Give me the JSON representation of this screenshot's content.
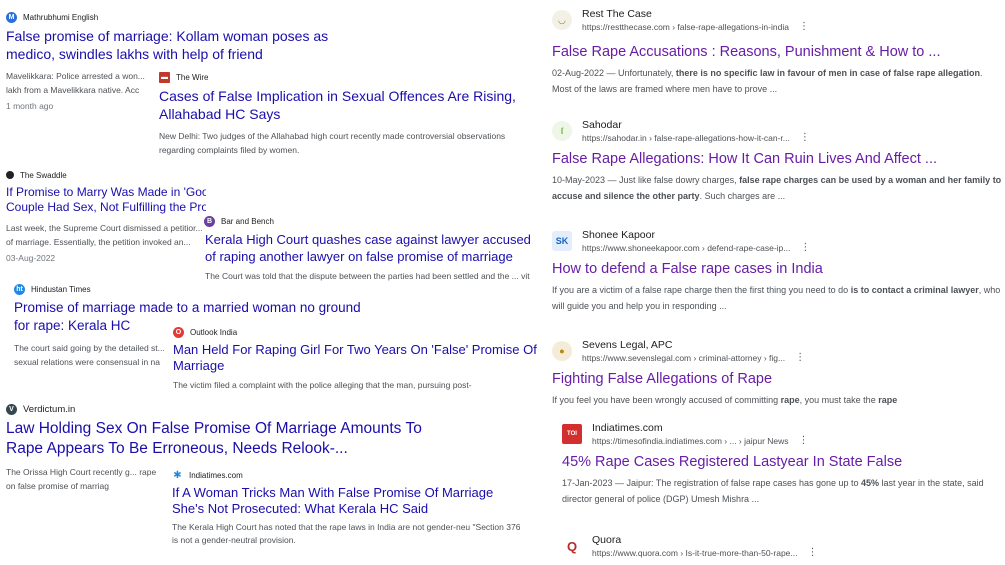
{
  "left": {
    "c1": {
      "source": "Mathrubhumi English",
      "title": "False promise of marriage: Kollam woman poses as medico, swindles lakhs with help of friend",
      "snippet": "Mavelikkara: Police arrested a won... lakh from a Mavelikkara native. Acc",
      "date": "1 month ago",
      "icon": "M"
    },
    "c2": {
      "source": "The Wire",
      "title": "Cases of False Implication in Sexual Offences Are Rising, Allahabad HC Says",
      "snippet": "New Delhi: Two judges of the Allahabad high court recently made controversial observations regarding complaints filed by women.",
      "icon": "▬"
    },
    "c3": {
      "source": "The Swaddle",
      "title": "If Promise to Marry Was Made in 'Good Faith' Before a Couple Had Sex, Not Fulfilling the Promise Isn't Rape: SC",
      "snippet": "Last week, the Supreme Court dismissed a petitior... of marriage. Essentially, the petition invoked an...",
      "date": "03-Aug-2022",
      "icon": "●"
    },
    "c4": {
      "source": "Bar and Bench",
      "title": "Kerala High Court quashes case against lawyer accused of raping another lawyer on false promise of marriage",
      "snippet": "The Court was told that the dispute between the parties had been settled and the ... vit that she has...",
      "icon": "B"
    },
    "c5": {
      "source": "Hindustan Times",
      "title": "Promise of marriage made to a married woman no ground for rape: Kerala HC",
      "snippet": "The court said going by the detailed st... sexual relations were consensual in na",
      "icon": "ht"
    },
    "c6": {
      "source": "Outlook India",
      "title": "Man Held For Raping Girl For Two Years On 'False' Promise Of Marriage",
      "snippet": "The victim filed a complaint with the police alleging that the man, pursuing post-",
      "icon": "O"
    },
    "c7": {
      "source": "Verdictum.in",
      "title": "Law Holding Sex On False Promise Of Marriage Amounts To Rape Appears To Be Erroneous, Needs Relook-...",
      "snippet": "The Orissa High Court recently g... rape on false promise of marriag",
      "icon": "V"
    },
    "c8": {
      "source": "Indiatimes.com",
      "title": "If A Woman Tricks Man With False Promise Of Marriage She's Not Prosecuted: What Kerala HC Said",
      "snippet": "The Kerala High Court has noted that the rape laws in India are not gender-neu \"Section 376 is not a gender-neutral provision.",
      "icon": "✱"
    }
  },
  "right": [
    {
      "name": "Rest The Case",
      "url": "https://restthecase.com › false-rape-allegations-in-india",
      "title": "False Rape Accusations : Reasons, Punishment & How to ...",
      "date": "02-Aug-2022 — ",
      "snippet_pre": "Unfortunately, ",
      "snippet_bold": "there is no specific law in favour of men in case of false rape allegation",
      "snippet_post": ". Most of the laws are framed where men have to prove ...",
      "icon": "◡"
    },
    {
      "name": "Sahodar",
      "url": "https://sahodar.in › false-rape-allegations-how-it-can-r...",
      "title": "False Rape Allegations: How It Can Ruin Lives And Affect ...",
      "date": "10-May-2023 — ",
      "snippet_pre": "Just like false dowry charges, ",
      "snippet_bold": "false rape charges can be used by a woman and her family to accuse and silence the other party",
      "snippet_post": ". Such charges are ...",
      "icon": "ſ"
    },
    {
      "name": "Shonee Kapoor",
      "url": "https://www.shoneekapoor.com › defend-rape-case-ip...",
      "title": "How to defend a False rape cases in India",
      "date": "",
      "snippet_pre": "If you are a victim of a false rape charge then the first thing you need to do ",
      "snippet_bold": "is to contact a criminal lawyer",
      "snippet_post": ", who will guide you and help you in responding ...",
      "icon": "SK"
    },
    {
      "name": "Sevens Legal, APC",
      "url": "https://www.sevenslegal.com › criminal-attorney › fig...",
      "title": "Fighting False Allegations of Rape",
      "date": "",
      "snippet_pre": "If you feel you have been wrongly accused of committing ",
      "snippet_bold": "rape",
      "snippet_post": ", you must take the ",
      "snippet_bold2": "rape",
      "icon": "●"
    },
    {
      "name": "Indiatimes.com",
      "url": "https://timesofindia.indiatimes.com › ... › jaipur News",
      "title": "45% Rape Cases Registered Lastyear In State False",
      "date": "17-Jan-2023 — ",
      "snippet_pre": "Jaipur: The registration of false rape cases has gone up to ",
      "snippet_bold": "45%",
      "snippet_post": " last year in the state, said director general of police (DGP) Umesh Mishra ...",
      "icon": "TOI"
    },
    {
      "name": "Quora",
      "url": "https://www.quora.com › Is-it-true-more-than-50-rape...",
      "icon": "Q"
    }
  ],
  "dots": "⋮"
}
